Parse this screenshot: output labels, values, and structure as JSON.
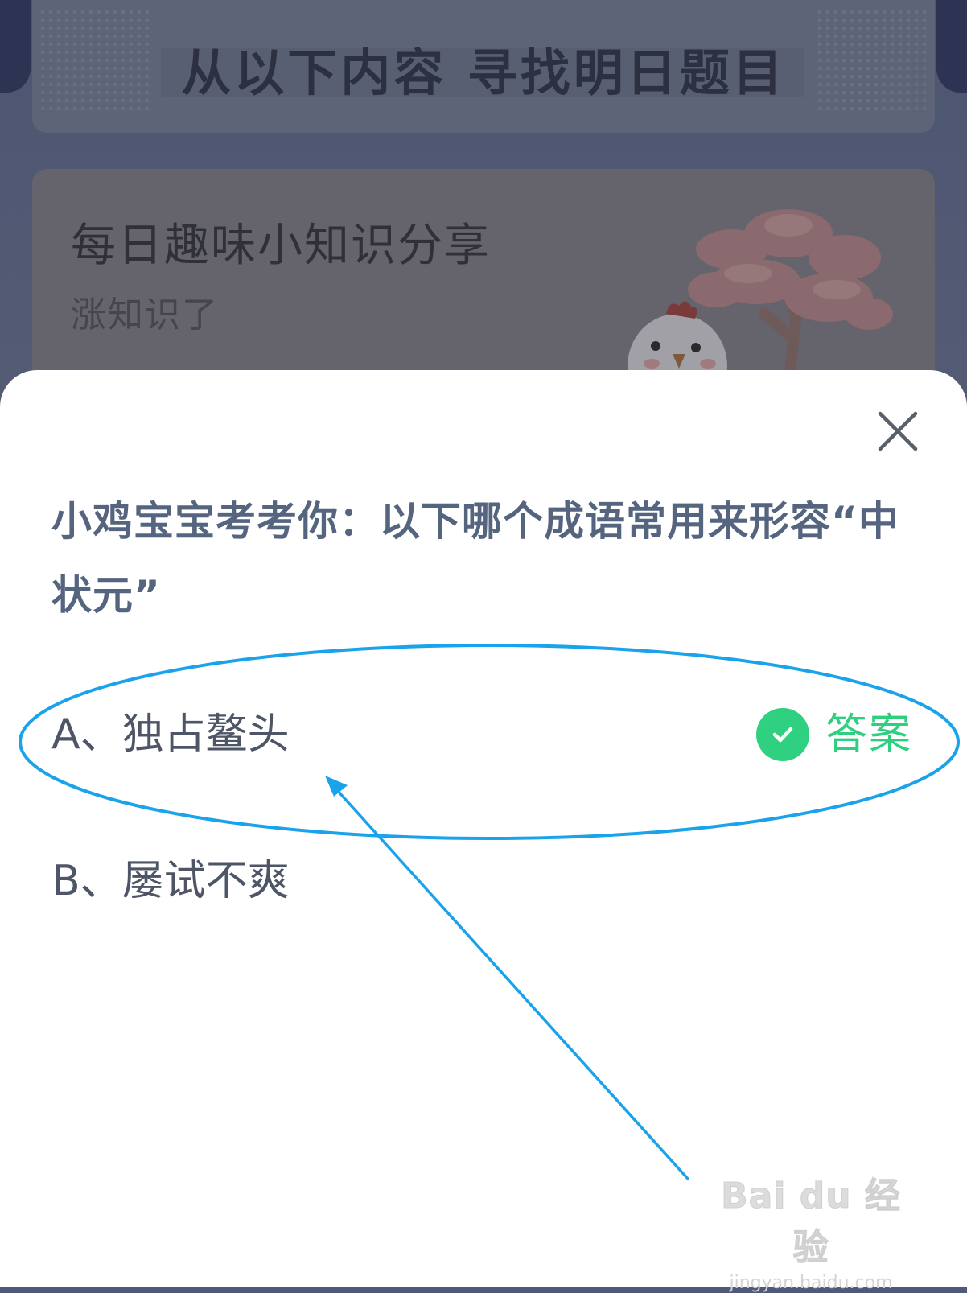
{
  "background": {
    "heading": "从以下内容  寻找明日题目",
    "card_title": "每日趣味小知识分享",
    "card_subtitle": "涨知识了"
  },
  "dialog": {
    "question": "小鸡宝宝考考你：以下哪个成语常用来形容“中状元”",
    "options": [
      {
        "label": "A、独占鳌头",
        "is_answer": true
      },
      {
        "label": "B、屡试不爽",
        "is_answer": false
      }
    ],
    "answer_label": "答案"
  },
  "watermark": {
    "logo": "Bai du 经验",
    "url": "jingyan.baidu.com"
  },
  "colors": {
    "question_text": "#56657f",
    "answer_green": "#2fd07f",
    "annotation_blue": "#1aa2ea"
  },
  "icons": [
    "close-icon",
    "check-circle-icon"
  ]
}
